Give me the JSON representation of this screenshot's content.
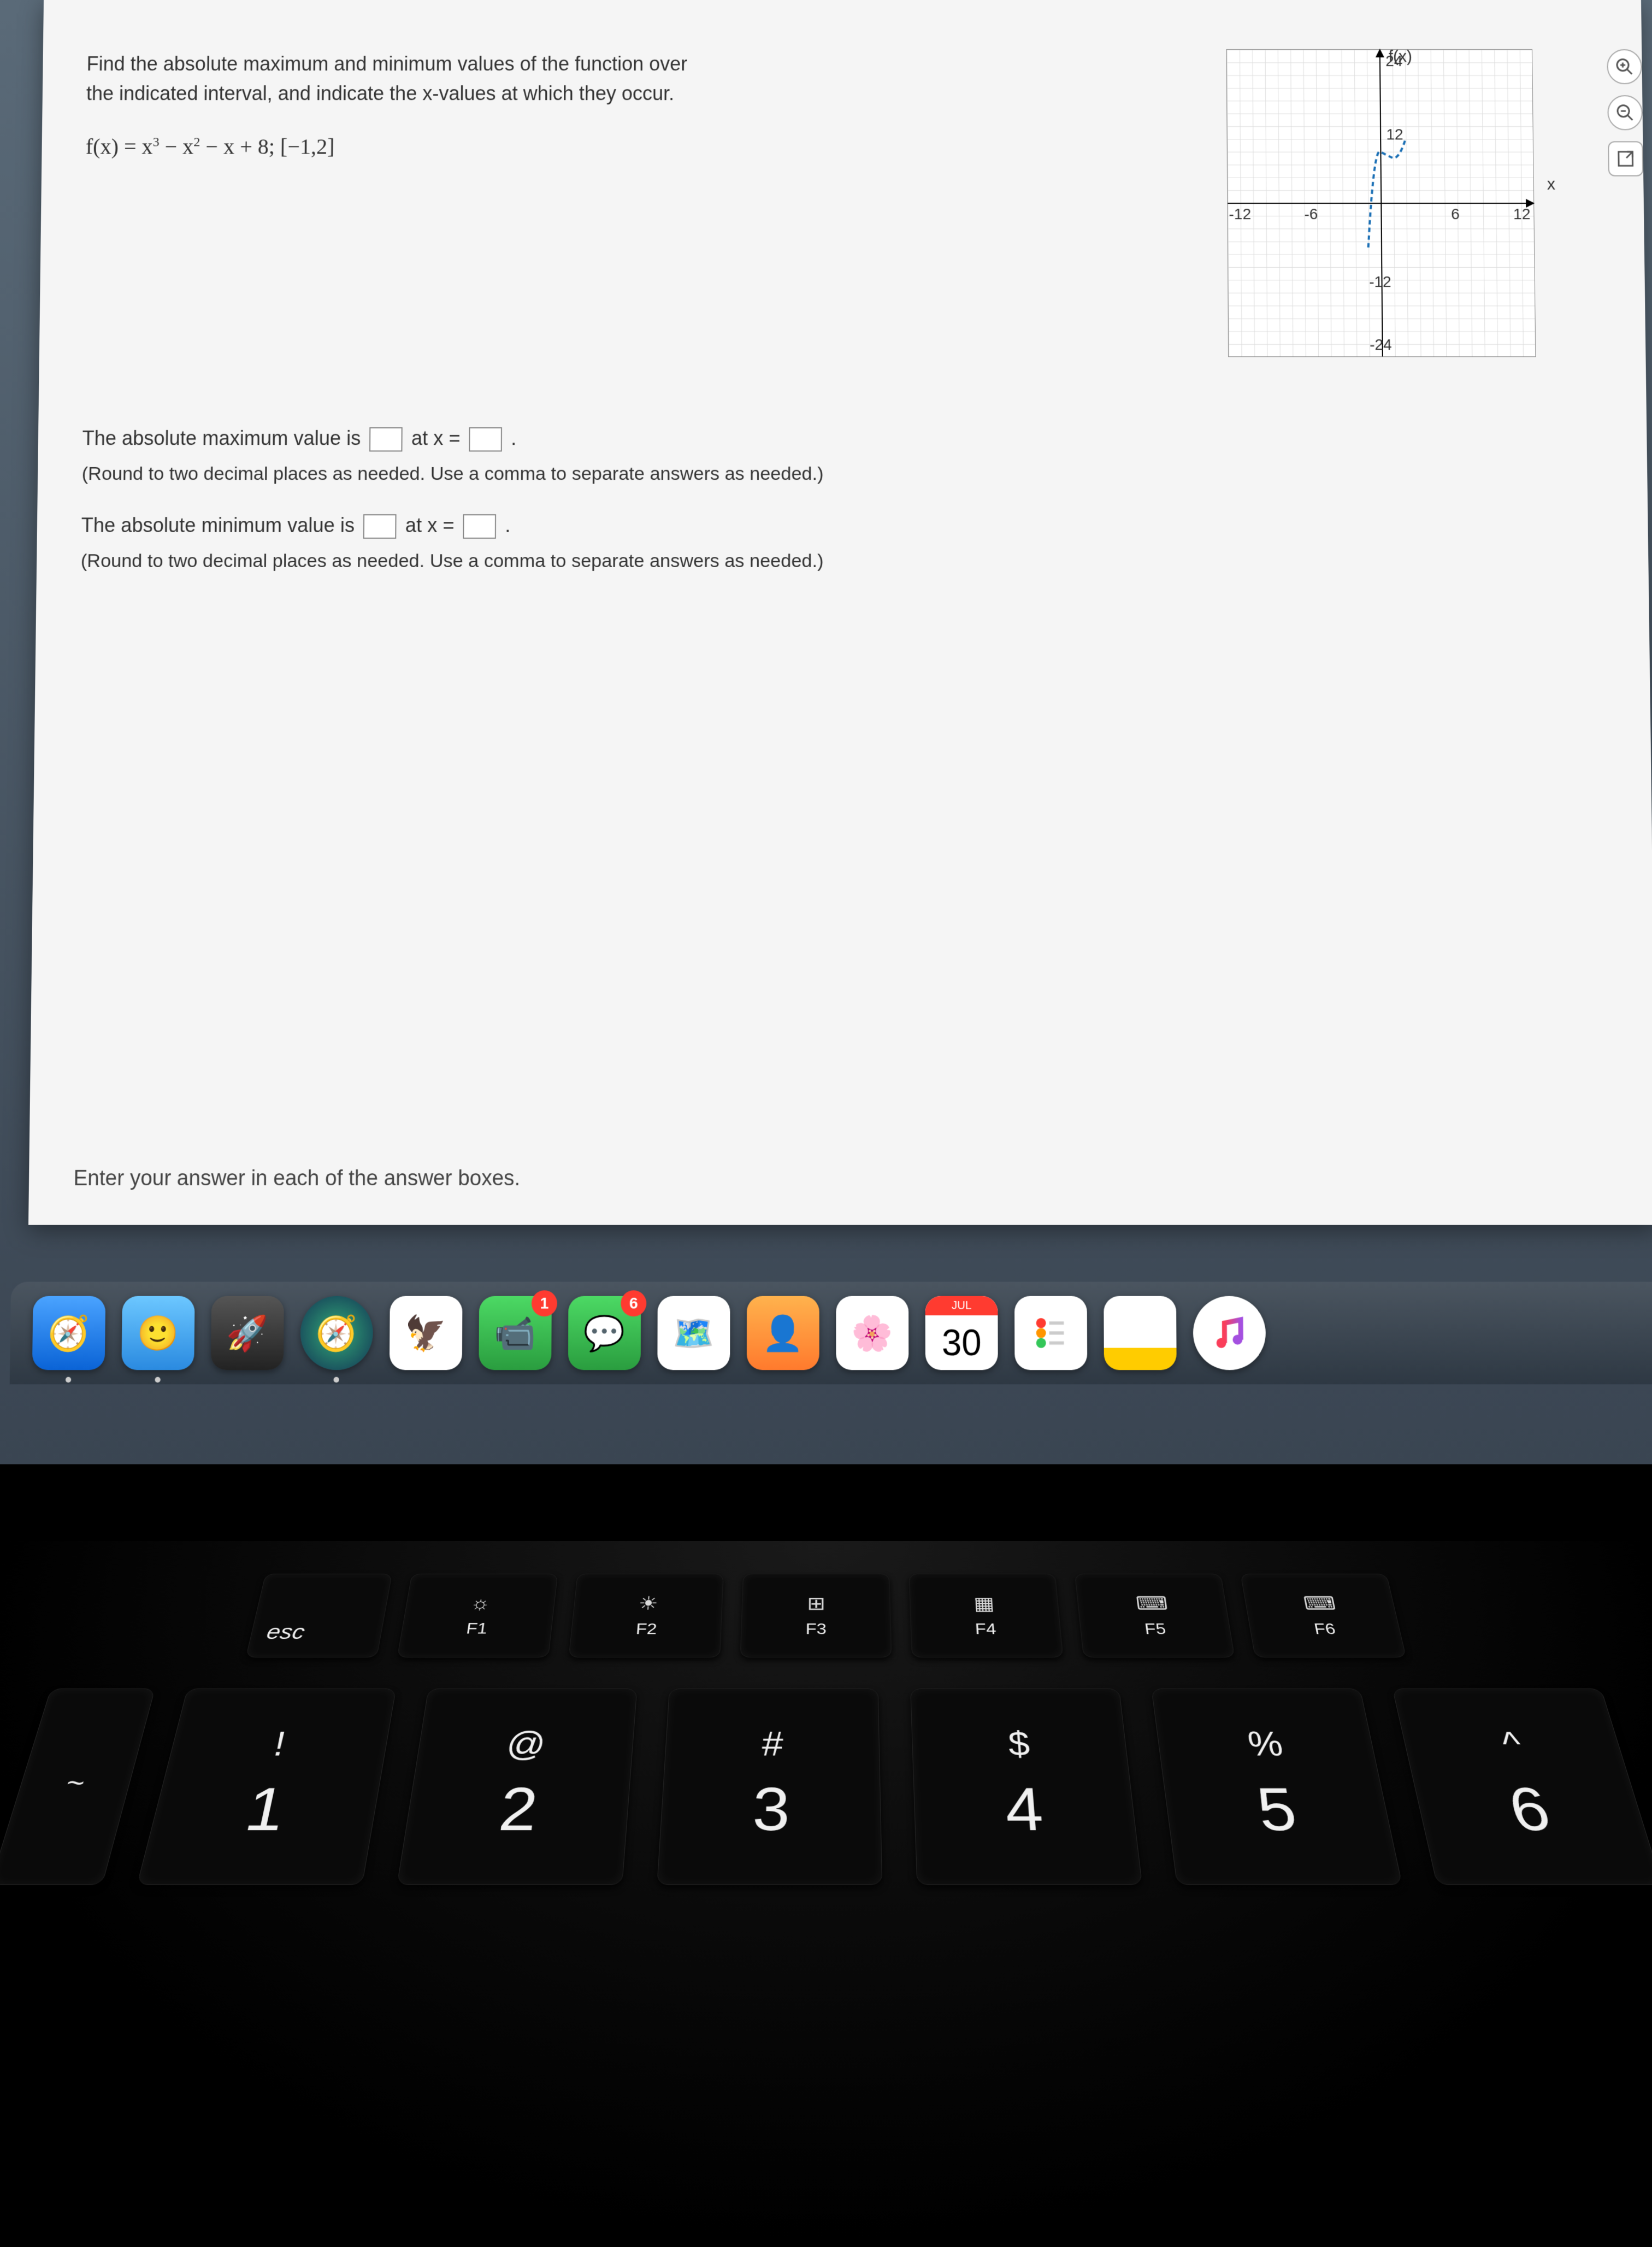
{
  "question": {
    "prompt_line1": "Find the absolute maximum and minimum values of the function over",
    "prompt_line2": "the indicated interval, and indicate the x-values at which they occur.",
    "formula_html": "f(x) = x³ − x² − x + 8; [−1,2]"
  },
  "graph": {
    "ylabel": "f(x)",
    "xlabel": "x",
    "x_ticks": [
      "-12",
      "-6",
      "6",
      "12"
    ],
    "y_ticks_pos": [
      "12",
      "24"
    ],
    "y_ticks_neg": [
      "-12",
      "-24"
    ]
  },
  "answers": {
    "max_pre": "The absolute maximum value is",
    "max_mid": "at x =",
    "max_post": ".",
    "min_pre": "The absolute minimum value is",
    "min_mid": "at x =",
    "min_post": ".",
    "hint": "(Round to two decimal places as needed. Use a comma to separate answers as needed.)"
  },
  "footer": "Enter your answer in each of the answer boxes.",
  "dock": {
    "calendar_month": "JUL",
    "calendar_day": "30",
    "badge_facetime": "1",
    "badge_messages": "6"
  },
  "keyboard": {
    "esc": "esc",
    "fn": [
      {
        "sym": "☼",
        "label": "F1"
      },
      {
        "sym": "☀",
        "label": "F2"
      },
      {
        "sym": "⊞",
        "label": "F3"
      },
      {
        "sym": "▦",
        "label": "F4"
      },
      {
        "sym": "⌨",
        "label": "F5"
      },
      {
        "sym": "⌨",
        "label": "F6"
      }
    ],
    "nums": [
      {
        "top": "!",
        "bot": "1"
      },
      {
        "top": "@",
        "bot": "2"
      },
      {
        "top": "#",
        "bot": "3"
      },
      {
        "top": "$",
        "bot": "4"
      },
      {
        "top": "%",
        "bot": "5"
      },
      {
        "top": "^",
        "bot": "6"
      }
    ]
  },
  "chart_data": {
    "type": "line",
    "title": "",
    "xlabel": "x",
    "ylabel": "f(x)",
    "xlim": [
      -12,
      12
    ],
    "ylim": [
      -24,
      24
    ],
    "x_ticks": [
      -12,
      -6,
      0,
      6,
      12
    ],
    "y_ticks": [
      -24,
      -12,
      0,
      12,
      24
    ],
    "series": [
      {
        "name": "f(x)=x^3-x^2-x+8 on [-1,2]",
        "x": [
          -1,
          -0.5,
          0,
          0.5,
          1,
          1.5,
          2
        ],
        "y": [
          7,
          8.125,
          8,
          7.625,
          7,
          7.625,
          10
        ]
      }
    ]
  }
}
